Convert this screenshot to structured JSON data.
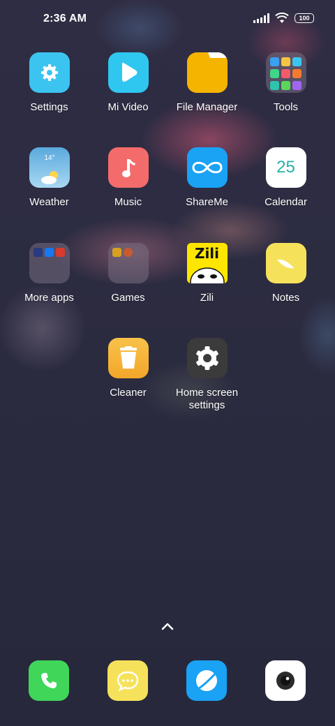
{
  "status_bar": {
    "time": "2:36 AM",
    "battery": "100",
    "icons": [
      "signal-icon",
      "wifi-icon",
      "battery-icon"
    ]
  },
  "apps": [
    {
      "label": "Settings",
      "icon": "settings-gear-icon",
      "color": "#3cc4f0"
    },
    {
      "label": "Mi Video",
      "icon": "play-icon",
      "color": "#2fc6f0"
    },
    {
      "label": "File Manager",
      "icon": "folder-icon",
      "color": "#f5b400"
    },
    {
      "label": "Tools",
      "icon": "folder-icon",
      "color": "#8c7c90"
    },
    {
      "label": "Weather",
      "icon": "weather-cloud-sun-icon",
      "color": "#6bb7e0",
      "temp": "14°"
    },
    {
      "label": "Music",
      "icon": "music-note-icon",
      "color": "#f36b6b"
    },
    {
      "label": "ShareMe",
      "icon": "infinity-icon",
      "color": "#1aa2f5"
    },
    {
      "label": "Calendar",
      "icon": "calendar-icon",
      "color": "#ffffff",
      "date": "25"
    },
    {
      "label": "More apps",
      "icon": "folder-icon",
      "color": "#5a5064"
    },
    {
      "label": "Games",
      "icon": "folder-icon",
      "color": "#5a5064"
    },
    {
      "label": "Zili",
      "icon": "zili-logo-icon",
      "color": "#ffe600",
      "brand": "Zili"
    },
    {
      "label": "Notes",
      "icon": "notes-leaf-icon",
      "color": "#f5e25a"
    },
    {
      "label": "Cleaner",
      "icon": "trash-bin-icon",
      "color": "#f7b43a"
    },
    {
      "label": "Home screen settings",
      "icon": "settings-gear-icon",
      "color": "#3b3b3b"
    }
  ],
  "dock": [
    {
      "name": "phone",
      "icon": "phone-icon",
      "color": "#3fd65a"
    },
    {
      "name": "messaging",
      "icon": "chat-bubble-icon",
      "color": "#f5e25a"
    },
    {
      "name": "browser",
      "icon": "browser-globe-icon",
      "color": "#1aa2f5"
    },
    {
      "name": "camera",
      "icon": "camera-icon",
      "color": "#ffffff"
    }
  ],
  "swipe_indicator": "chevron-up-icon"
}
